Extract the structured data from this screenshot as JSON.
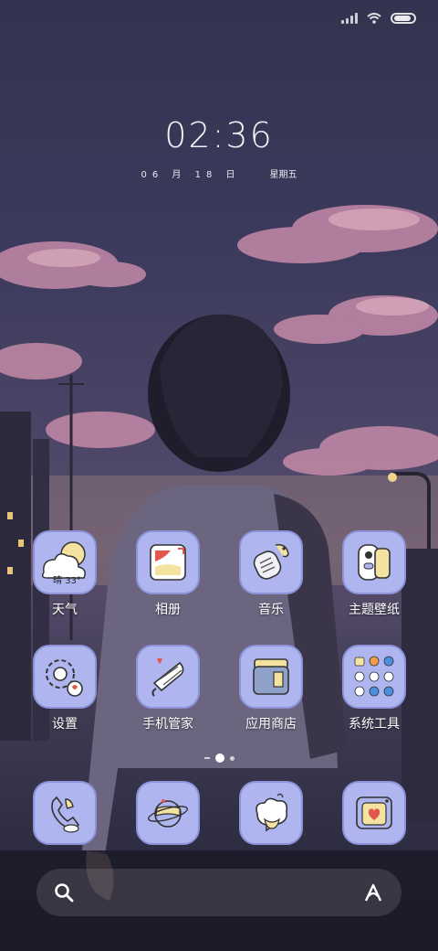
{
  "clock": {
    "time": "02:36"
  },
  "date": {
    "day": "06 月 18 日",
    "weekday": "星期五"
  },
  "weather": {
    "condition": "晴",
    "temp": "33°"
  },
  "apps_row1": [
    {
      "label": "天气",
      "icon": "weather-icon"
    },
    {
      "label": "相册",
      "icon": "gallery-icon"
    },
    {
      "label": "音乐",
      "icon": "music-icon"
    },
    {
      "label": "主题壁纸",
      "icon": "themes-icon"
    }
  ],
  "apps_row2": [
    {
      "label": "设置",
      "icon": "settings-icon"
    },
    {
      "label": "手机管家",
      "icon": "security-icon"
    },
    {
      "label": "应用商店",
      "icon": "app-store-icon"
    },
    {
      "label": "系统工具",
      "icon": "tools-folder-icon"
    }
  ],
  "dock": [
    {
      "icon": "phone-icon"
    },
    {
      "icon": "browser-icon"
    },
    {
      "icon": "messages-icon"
    },
    {
      "icon": "camera-icon"
    }
  ],
  "search": {
    "left_icon": "search-icon",
    "right_icon": "assistant-icon"
  },
  "status": {
    "signal_icon": "signal-icon",
    "wifi_icon": "wifi-icon",
    "battery_icon": "battery-icon",
    "battery_level": 0.9
  },
  "colors": {
    "tile_bg": "#aeb5ef",
    "tile_border": "#8c93d8",
    "accent_red": "#e2574c",
    "accent_yellow": "#f4e2a0"
  }
}
